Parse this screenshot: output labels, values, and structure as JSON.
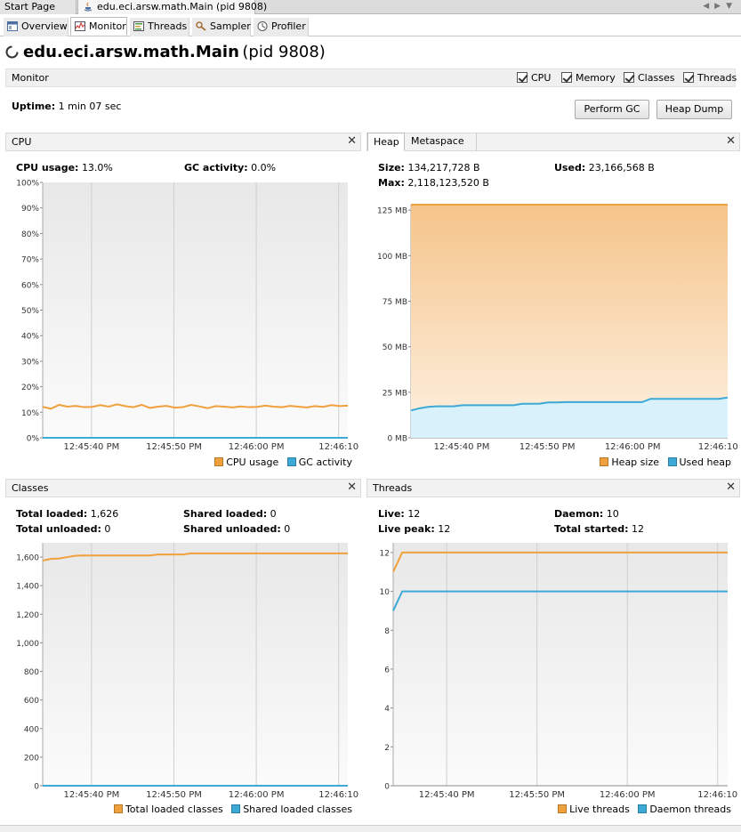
{
  "doc_tabs": [
    {
      "label": "Start Page"
    },
    {
      "label": "edu.eci.arsw.math.Main (pid 9808)"
    }
  ],
  "view_tabs": [
    {
      "label": "Overview",
      "icon": "overview-icon"
    },
    {
      "label": "Monitor",
      "icon": "monitor-icon"
    },
    {
      "label": "Threads",
      "icon": "threads-icon"
    },
    {
      "label": "Sampler",
      "icon": "sampler-icon"
    },
    {
      "label": "Profiler",
      "icon": "profiler-icon"
    }
  ],
  "title": {
    "name": "edu.eci.arsw.math.Main",
    "pid": "(pid 9808)"
  },
  "monitor": {
    "label": "Monitor",
    "checkboxes": [
      {
        "label": "CPU",
        "checked": true
      },
      {
        "label": "Memory",
        "checked": true
      },
      {
        "label": "Classes",
        "checked": true
      },
      {
        "label": "Threads",
        "checked": true
      }
    ]
  },
  "uptime": {
    "label": "Uptime:",
    "value": "1 min 07 sec"
  },
  "buttons": {
    "perform_gc": "Perform GC",
    "heap_dump": "Heap Dump"
  },
  "colors": {
    "orange": "#f0a03c",
    "blue": "#3ca9d6",
    "orange_fill_top": "#f5c48a",
    "orange_fill_bottom": "#fdf1e2",
    "blue_fill": "#d9f1fb"
  },
  "panels": {
    "cpu": {
      "title": "CPU",
      "stats": [
        {
          "label": "CPU usage:",
          "value": "13.0%"
        },
        {
          "label": "GC activity:",
          "value": "0.0%"
        }
      ],
      "legend": [
        "CPU usage",
        "GC activity"
      ]
    },
    "heap": {
      "tabs": [
        "Heap",
        "Metaspace"
      ],
      "stats": [
        {
          "label": "Size:",
          "value": "134,217,728 B"
        },
        {
          "label": "Used:",
          "value": "23,166,568 B"
        },
        {
          "label": "Max:",
          "value": "2,118,123,520 B"
        }
      ],
      "legend": [
        "Heap size",
        "Used heap"
      ]
    },
    "classes": {
      "title": "Classes",
      "stats": [
        {
          "label": "Total loaded:",
          "value": "1,626"
        },
        {
          "label": "Shared loaded:",
          "value": "0"
        },
        {
          "label": "Total unloaded:",
          "value": "0"
        },
        {
          "label": "Shared unloaded:",
          "value": "0"
        }
      ],
      "legend": [
        "Total loaded classes",
        "Shared loaded classes"
      ]
    },
    "threads": {
      "title": "Threads",
      "stats": [
        {
          "label": "Live:",
          "value": "12"
        },
        {
          "label": "Daemon:",
          "value": "10"
        },
        {
          "label": "Live peak:",
          "value": "12"
        },
        {
          "label": "Total started:",
          "value": "12"
        }
      ],
      "legend": [
        "Live threads",
        "Daemon threads"
      ]
    }
  },
  "chart_data": [
    {
      "id": "cpu",
      "type": "line",
      "yticks": [
        "0%",
        "10%",
        "20%",
        "30%",
        "40%",
        "50%",
        "60%",
        "70%",
        "80%",
        "90%",
        "100%"
      ],
      "ylim": [
        0,
        100
      ],
      "xticks": [
        "12:45:40 PM",
        "12:45:50 PM",
        "12:46:00 PM",
        "12:46:10"
      ],
      "series": [
        {
          "name": "CPU usage",
          "color": "#f0a03c",
          "x": [
            0,
            1,
            2,
            3,
            4,
            5,
            6,
            7,
            8,
            9,
            10,
            11,
            12,
            13,
            14,
            15,
            16,
            17,
            18,
            19,
            20,
            21,
            22,
            23,
            24,
            25,
            26,
            27,
            28,
            29,
            30,
            31,
            32,
            33,
            34,
            35,
            36,
            37
          ],
          "values": [
            12.1,
            11.4,
            12.9,
            12.2,
            12.5,
            12.0,
            12.1,
            12.8,
            12.2,
            13.1,
            12.4,
            12.0,
            12.9,
            11.7,
            12.2,
            12.5,
            11.8,
            12.0,
            12.9,
            12.3,
            11.6,
            12.4,
            12.2,
            11.9,
            12.3,
            12.0,
            12.1,
            12.6,
            12.2,
            12.0,
            12.5,
            12.2,
            11.9,
            12.4,
            12.1,
            12.8,
            12.4,
            12.6
          ]
        },
        {
          "name": "GC activity",
          "color": "#3ca9d6",
          "x": [
            0,
            37
          ],
          "values": [
            0,
            0
          ]
        }
      ]
    },
    {
      "id": "heap",
      "type": "area",
      "yticks": [
        "0 MB",
        "25 MB",
        "50 MB",
        "75 MB",
        "100 MB",
        "125 MB"
      ],
      "ylim": [
        0,
        128
      ],
      "xticks": [
        "12:45:40 PM",
        "12:45:50 PM",
        "12:46:00 PM",
        "12:46:10"
      ],
      "series": [
        {
          "name": "Heap size",
          "color": "#f0a03c",
          "x": [
            0,
            37
          ],
          "values": [
            128,
            128
          ]
        },
        {
          "name": "Used heap",
          "color": "#3ca9d6",
          "x": [
            0,
            1,
            2,
            3,
            5,
            6,
            12,
            13,
            15,
            16,
            17,
            18,
            27,
            28,
            36,
            37
          ],
          "values": [
            15.0,
            16.2,
            17.0,
            17.3,
            17.3,
            17.9,
            17.9,
            18.7,
            18.7,
            19.4,
            19.4,
            19.6,
            19.6,
            21.4,
            21.4,
            22.1
          ]
        }
      ]
    },
    {
      "id": "classes",
      "type": "line",
      "yticks": [
        "0",
        "200",
        "400",
        "600",
        "800",
        "1,000",
        "1,200",
        "1,400",
        "1,600"
      ],
      "ylim": [
        0,
        1700
      ],
      "xticks": [
        "12:45:40 PM",
        "12:45:50 PM",
        "12:46:00 PM",
        "12:46:10"
      ],
      "series": [
        {
          "name": "Total loaded classes",
          "color": "#f0a03c",
          "x": [
            0,
            1,
            2,
            3,
            4,
            5,
            13,
            14,
            17,
            18,
            37
          ],
          "values": [
            1575,
            1588,
            1590,
            1600,
            1610,
            1611,
            1611,
            1618,
            1618,
            1626,
            1626
          ]
        },
        {
          "name": "Shared loaded classes",
          "color": "#3ca9d6",
          "x": [
            0,
            37
          ],
          "values": [
            0,
            0
          ]
        }
      ]
    },
    {
      "id": "threads",
      "type": "line",
      "yticks": [
        "0",
        "2",
        "4",
        "6",
        "8",
        "10",
        "12"
      ],
      "ylim": [
        0,
        12.5
      ],
      "xticks": [
        "12:45:40 PM",
        "12:45:50 PM",
        "12:46:00 PM",
        "12:46:10"
      ],
      "series": [
        {
          "name": "Live threads",
          "color": "#f0a03c",
          "x": [
            0,
            1,
            37
          ],
          "values": [
            11,
            12,
            12
          ]
        },
        {
          "name": "Daemon threads",
          "color": "#3ca9d6",
          "x": [
            0,
            1,
            37
          ],
          "values": [
            9,
            10,
            10
          ]
        }
      ]
    }
  ]
}
